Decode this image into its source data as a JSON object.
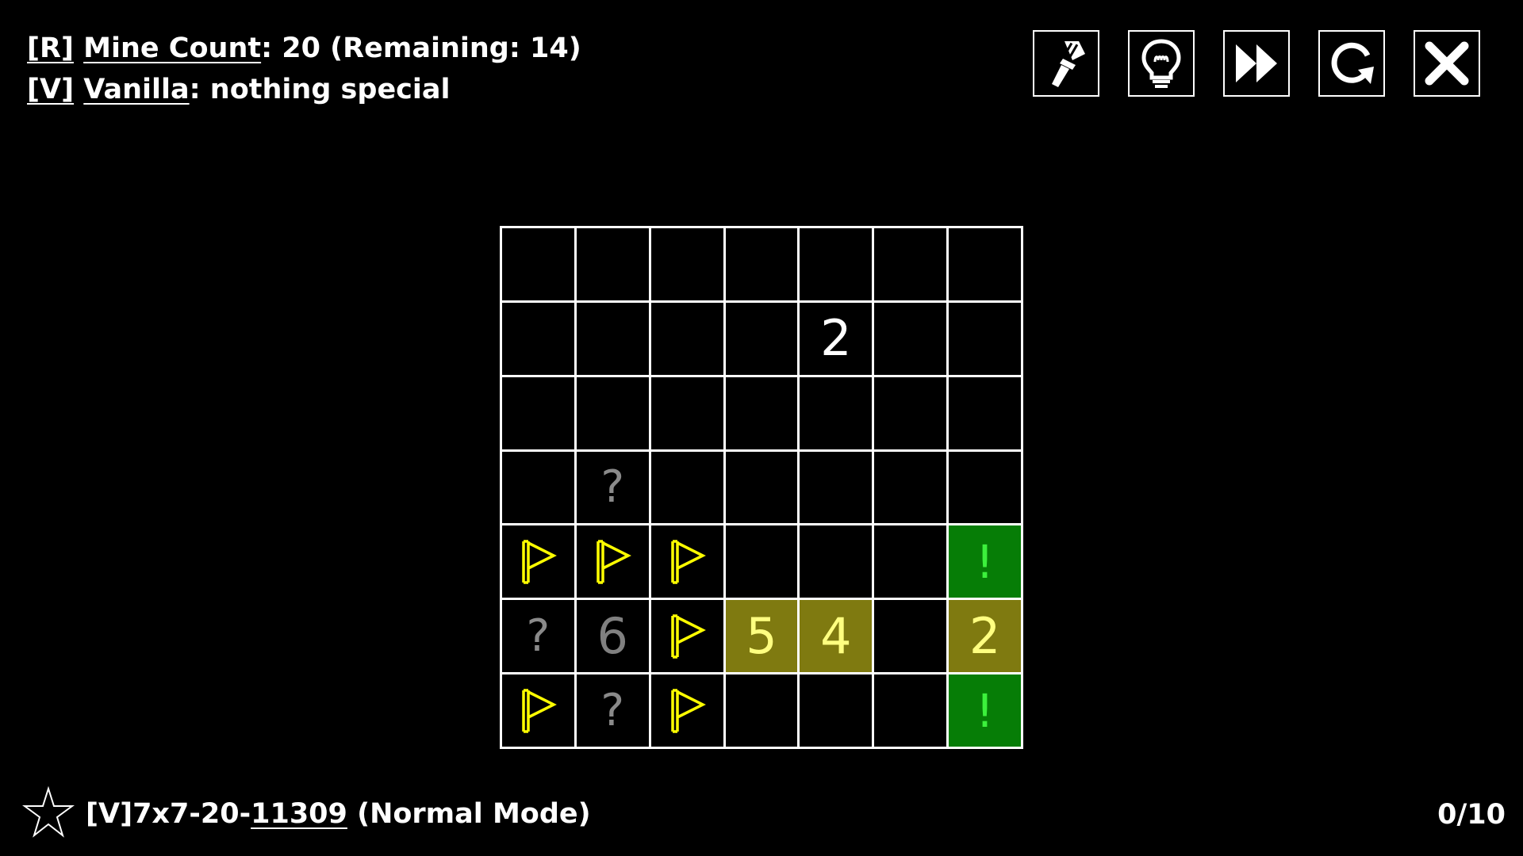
{
  "rules": {
    "line1_key": "[R]",
    "line1_name": "Mine Count",
    "line1_value": ":  20 (Remaining: 14)",
    "line2_key": "[V]",
    "line2_name": "Vanilla",
    "line2_value": ": nothing special"
  },
  "toolbar": {
    "buttons": [
      "paintbrush-icon",
      "lightbulb-icon",
      "fast-forward-icon",
      "restart-icon",
      "close-icon"
    ]
  },
  "board": {
    "size": "7x7",
    "cells": [
      [
        "",
        "",
        "",
        "",
        "",
        "",
        ""
      ],
      [
        "",
        "",
        "",
        "",
        "2",
        "",
        ""
      ],
      [
        "",
        "",
        "",
        "",
        "",
        "",
        ""
      ],
      [
        "",
        "?",
        "",
        "",
        "",
        "",
        ""
      ],
      [
        "flag",
        "flag",
        "flag",
        "",
        "",
        "",
        "!"
      ],
      [
        "?",
        "6",
        "flag",
        "5",
        "4",
        "",
        "2"
      ],
      [
        "flag",
        "?",
        "flag",
        "",
        "",
        "",
        "!"
      ]
    ],
    "styles": [
      [
        "",
        "",
        "",
        "",
        "",
        "",
        ""
      ],
      [
        "",
        "",
        "",
        "",
        "num",
        "",
        ""
      ],
      [
        "",
        "",
        "",
        "",
        "",
        "",
        ""
      ],
      [
        "",
        "q",
        "",
        "",
        "",
        "",
        ""
      ],
      [
        "",
        "",
        "",
        "",
        "",
        "",
        "green"
      ],
      [
        "q",
        "gray",
        "",
        "olive",
        "olive",
        "",
        "olive"
      ],
      [
        "",
        "q",
        "",
        "",
        "",
        "",
        "green"
      ]
    ],
    "colors": {
      "flag": "#ffff00",
      "olive": "#7f7a10",
      "green": "#067d06",
      "exclaim": "#3cf03c"
    }
  },
  "footer": {
    "level_prefix": "[V]7x7-20-",
    "level_id": "11309",
    "level_mode": " (Normal Mode)",
    "progress": "0/10"
  }
}
